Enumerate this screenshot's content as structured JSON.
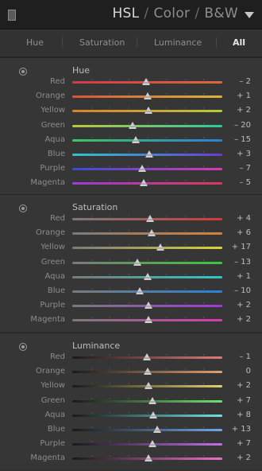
{
  "header": {
    "title_parts": [
      "HSL",
      "Color",
      "B&W"
    ],
    "separator": "/"
  },
  "tabs": [
    {
      "label": "Hue"
    },
    {
      "label": "Saturation"
    },
    {
      "label": "Luminance"
    },
    {
      "label": "All",
      "active": true
    }
  ],
  "sections": [
    {
      "title": "Hue",
      "rows": [
        {
          "label": "Red",
          "value": "– 2",
          "amount": -2,
          "colors": [
            "#d23a4a",
            "#d86a3a"
          ]
        },
        {
          "label": "Orange",
          "value": "+ 1",
          "amount": 1,
          "colors": [
            "#d8553a",
            "#d8b43a"
          ]
        },
        {
          "label": "Yellow",
          "value": "+ 2",
          "amount": 2,
          "colors": [
            "#d8802a",
            "#b8c83a"
          ]
        },
        {
          "label": "Green",
          "value": "– 20",
          "amount": -20,
          "colors": [
            "#b8c83a",
            "#2ac8a0"
          ]
        },
        {
          "label": "Aqua",
          "value": "– 15",
          "amount": -15,
          "colors": [
            "#3ac860",
            "#2a80d8"
          ]
        },
        {
          "label": "Blue",
          "value": "+ 3",
          "amount": 3,
          "colors": [
            "#2ac8c8",
            "#6a3ad8"
          ]
        },
        {
          "label": "Purple",
          "value": "– 7",
          "amount": -7,
          "colors": [
            "#3a4ad8",
            "#d83ab0"
          ]
        },
        {
          "label": "Magenta",
          "value": "– 5",
          "amount": -5,
          "colors": [
            "#a03ad8",
            "#d83a5a"
          ]
        }
      ]
    },
    {
      "title": "Saturation",
      "rows": [
        {
          "label": "Red",
          "value": "+ 4",
          "amount": 4,
          "colors": [
            "#7a7a7a",
            "#d23a3a"
          ]
        },
        {
          "label": "Orange",
          "value": "+ 6",
          "amount": 6,
          "colors": [
            "#7a7a7a",
            "#d8803a"
          ]
        },
        {
          "label": "Yellow",
          "value": "+ 17",
          "amount": 17,
          "colors": [
            "#7a7a7a",
            "#d8d23a"
          ]
        },
        {
          "label": "Green",
          "value": "– 13",
          "amount": -13,
          "colors": [
            "#7a7a7a",
            "#3ac83a"
          ]
        },
        {
          "label": "Aqua",
          "value": "+ 1",
          "amount": 1,
          "colors": [
            "#7a7a7a",
            "#2ac8c8"
          ]
        },
        {
          "label": "Blue",
          "value": "– 10",
          "amount": -10,
          "colors": [
            "#7a7a7a",
            "#2a80d8"
          ]
        },
        {
          "label": "Purple",
          "value": "+ 2",
          "amount": 2,
          "colors": [
            "#7a7a7a",
            "#a03ad8"
          ]
        },
        {
          "label": "Magenta",
          "value": "+ 2",
          "amount": 2,
          "colors": [
            "#7a7a7a",
            "#d83ab0"
          ]
        }
      ]
    },
    {
      "title": "Luminance",
      "rows": [
        {
          "label": "Red",
          "value": "– 1",
          "amount": -1,
          "colors": [
            "#1a1a1a",
            "#e07a7a"
          ]
        },
        {
          "label": "Orange",
          "value": "0",
          "amount": 0,
          "colors": [
            "#1a1a1a",
            "#e0a070"
          ]
        },
        {
          "label": "Yellow",
          "value": "+ 2",
          "amount": 2,
          "colors": [
            "#1a1a1a",
            "#e0d070"
          ]
        },
        {
          "label": "Green",
          "value": "+ 7",
          "amount": 7,
          "colors": [
            "#1a1a1a",
            "#70e070"
          ]
        },
        {
          "label": "Aqua",
          "value": "+ 8",
          "amount": 8,
          "colors": [
            "#1a1a1a",
            "#70e0e0"
          ]
        },
        {
          "label": "Blue",
          "value": "+ 13",
          "amount": 13,
          "colors": [
            "#1a1a1a",
            "#70a8e8"
          ]
        },
        {
          "label": "Purple",
          "value": "+ 7",
          "amount": 7,
          "colors": [
            "#1a1a1a",
            "#c070e8"
          ]
        },
        {
          "label": "Magenta",
          "value": "+ 2",
          "amount": 2,
          "colors": [
            "#1a1a1a",
            "#e870c8"
          ]
        }
      ]
    }
  ],
  "slider_range": [
    -100,
    100
  ]
}
